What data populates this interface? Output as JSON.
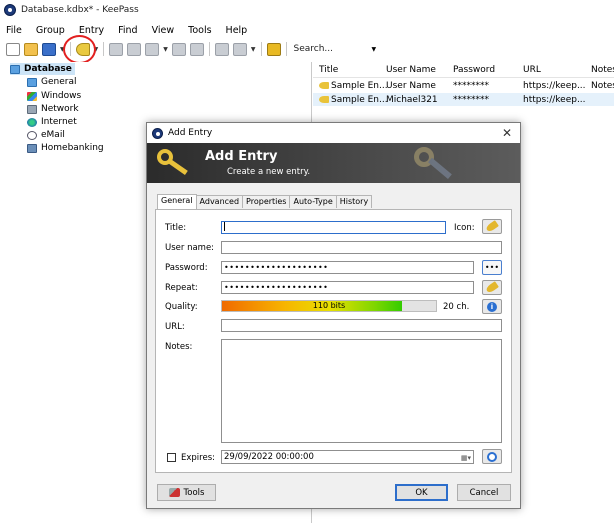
{
  "window": {
    "title": "Database.kdbx* - KeePass"
  },
  "menu": [
    "File",
    "Group",
    "Entry",
    "Find",
    "View",
    "Tools",
    "Help"
  ],
  "toolbar": {
    "search_placeholder": "Search..."
  },
  "tree": {
    "root": "Database",
    "groups": [
      "General",
      "Windows",
      "Network",
      "Internet",
      "eMail",
      "Homebanking"
    ]
  },
  "entries": {
    "columns": [
      "Title",
      "User Name",
      "Password",
      "URL",
      "Notes"
    ],
    "rows": [
      {
        "title": "Sample En...",
        "username": "User Name",
        "password": "********",
        "url": "https://keep...",
        "notes": "Notes"
      },
      {
        "title": "Sample En...",
        "username": "Michael321",
        "password": "********",
        "url": "https://keep...",
        "notes": ""
      }
    ]
  },
  "dialog": {
    "title": "Add Entry",
    "banner_title": "Add Entry",
    "banner_subtitle": "Create a new entry.",
    "tabs": [
      "General",
      "Advanced",
      "Properties",
      "Auto-Type",
      "History"
    ],
    "labels": {
      "title": "Title:",
      "icon": "Icon:",
      "username": "User name:",
      "password": "Password:",
      "repeat": "Repeat:",
      "quality": "Quality:",
      "url": "URL:",
      "notes": "Notes:",
      "expires": "Expires:"
    },
    "values": {
      "title": "",
      "username": "",
      "password_masked": "••••••••••••••••••••",
      "repeat_masked": "••••••••••••••••••••",
      "url": "",
      "notes": "",
      "expires": "29/09/2022 00:00:00"
    },
    "quality": {
      "bits_text": "110 bits",
      "chars_text": "20 ch.",
      "fraction": 0.84
    },
    "buttons": {
      "dots": "•••",
      "info": "i",
      "tools": "Tools",
      "ok": "OK",
      "cancel": "Cancel"
    },
    "expires_checked": false
  }
}
